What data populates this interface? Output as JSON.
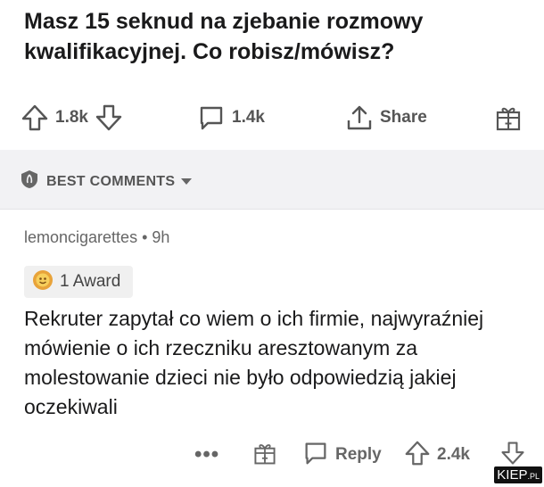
{
  "post": {
    "title": "Masz 15 seknud na zjebanie rozmowy kwalifikacyjnej. Co robisz/mówisz?",
    "upvotes": "1.8k",
    "comments_count": "1.4k",
    "share_label": "Share"
  },
  "sort": {
    "label": "BEST COMMENTS"
  },
  "comment": {
    "username": "lemoncigarettes",
    "separator": "•",
    "age": "9h",
    "award_label": "1 Award",
    "body": "Rekruter zapytał co wiem o ich firmie, najwyraźniej mówienie o ich rzeczniku aresztowanym za molestowanie dzieci nie było odpowiedzią jakiej oczekiwali",
    "more_label": "•••",
    "reply_label": "Reply",
    "votes": "2.4k"
  },
  "watermark": {
    "main": "KIEP",
    "suffix": ".PL"
  },
  "icons": [
    "arrow-up-icon",
    "arrow-down-icon",
    "comment-bubble-icon",
    "share-icon",
    "gift-icon",
    "shield-icon",
    "caret-down-icon",
    "award-medal-icon"
  ]
}
